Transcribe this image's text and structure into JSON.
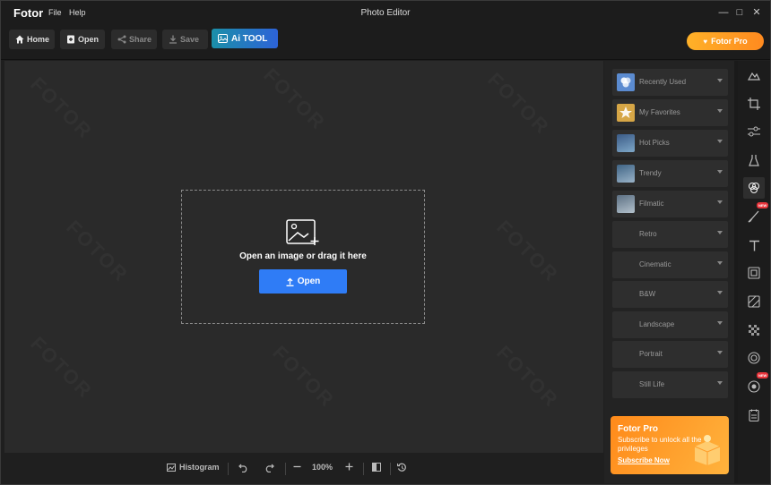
{
  "app": {
    "brand": "Fotor",
    "title": "Photo Editor"
  },
  "menu": [
    "File",
    "Help"
  ],
  "window_controls": {
    "minimize": "—",
    "maximize": "□",
    "close": "✕"
  },
  "toolbar": {
    "home": "Home",
    "open": "Open",
    "share": "Share",
    "save": "Save",
    "ai_tool": "Ai TOOL",
    "pro": "Fotor Pro"
  },
  "canvas": {
    "watermark": "FOTOR",
    "drop_text": "Open an image or drag it here",
    "open_button": "Open"
  },
  "bottom": {
    "histogram": "Histogram",
    "zoom": "100%"
  },
  "filters": [
    {
      "label": "Recently Used",
      "thumb": "#5b8bd0"
    },
    {
      "label": "My Favorites",
      "thumb": "#d6a646"
    },
    {
      "label": "Hot Picks",
      "thumb": "#4a6f9a"
    },
    {
      "label": "Trendy",
      "thumb": "#5a7a96"
    },
    {
      "label": "Filmatic",
      "thumb": "#7a8c9e"
    },
    {
      "label": "Retro",
      "thumb": ""
    },
    {
      "label": "Cinematic",
      "thumb": ""
    },
    {
      "label": "B&W",
      "thumb": ""
    },
    {
      "label": "Landscape",
      "thumb": ""
    },
    {
      "label": "Portrait",
      "thumb": ""
    },
    {
      "label": "Still Life",
      "thumb": ""
    }
  ],
  "promo": {
    "title": "Fotor Pro",
    "subtitle": "Subscribe to unlock all the privileges",
    "link": "Subscribe Now"
  },
  "rail": {
    "new_badge": "NEW",
    "icons": [
      "landscape-icon",
      "crop-icon",
      "adjust-sliders-icon",
      "beaker-icon",
      "effects-circles-icon",
      "brush-icon",
      "text-icon",
      "frame-icon",
      "sticker-icon",
      "mosaic-icon",
      "circle-icon",
      "ai-circle-icon",
      "notes-icon"
    ]
  },
  "colors": {
    "accent": "#2f7cf6",
    "pro": "#ff9a1f",
    "ai": "#1b8fa8"
  }
}
